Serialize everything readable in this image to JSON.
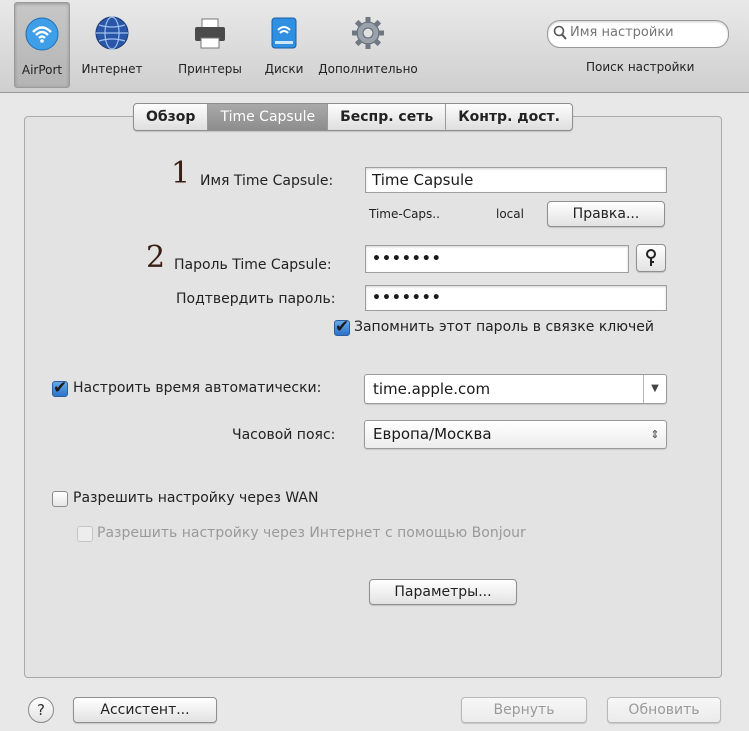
{
  "toolbar": {
    "items": [
      {
        "label": "AirPort",
        "icon": "airport-icon"
      },
      {
        "label": "Интернет",
        "icon": "globe-icon"
      },
      {
        "label": "Принтеры",
        "icon": "printer-icon"
      },
      {
        "label": "Диски",
        "icon": "disk-icon"
      },
      {
        "label": "Дополнительно",
        "icon": "gear-icon"
      }
    ],
    "search_placeholder": "Имя настройки",
    "search_label": "Поиск настройки"
  },
  "tabs": [
    "Обзор",
    "Time Capsule",
    "Беспр. сеть",
    "Контр. дост."
  ],
  "form": {
    "step1": "1",
    "step2": "2",
    "name_label": "Имя Time Capsule:",
    "name_value": "Time Capsule",
    "host_short": "Time-Caps..",
    "host_domain": "local",
    "edit_button": "Правка...",
    "password_label": "Пароль Time Capsule:",
    "password_value": "•••••••",
    "confirm_label": "Подтвердить пароль:",
    "confirm_value": "•••••••",
    "keychain_label": "Запомнить этот пароль в связке ключей",
    "auto_time_label": "Настроить время автоматически:",
    "time_server": "time.apple.com",
    "timezone_label": "Часовой пояс:",
    "timezone_value": "Европа/Москва",
    "wan_label": "Разрешить настройку через WAN",
    "bonjour_label": "Разрешить настройку через Интернет с помощью Bonjour",
    "params_button": "Параметры..."
  },
  "footer": {
    "help": "?",
    "assistant": "Ассистент...",
    "revert": "Вернуть",
    "update": "Обновить"
  },
  "colors": {
    "selected_tab": "#999999",
    "checkbox_blue": "#2b73c9",
    "number_color": "#3a1e14"
  }
}
